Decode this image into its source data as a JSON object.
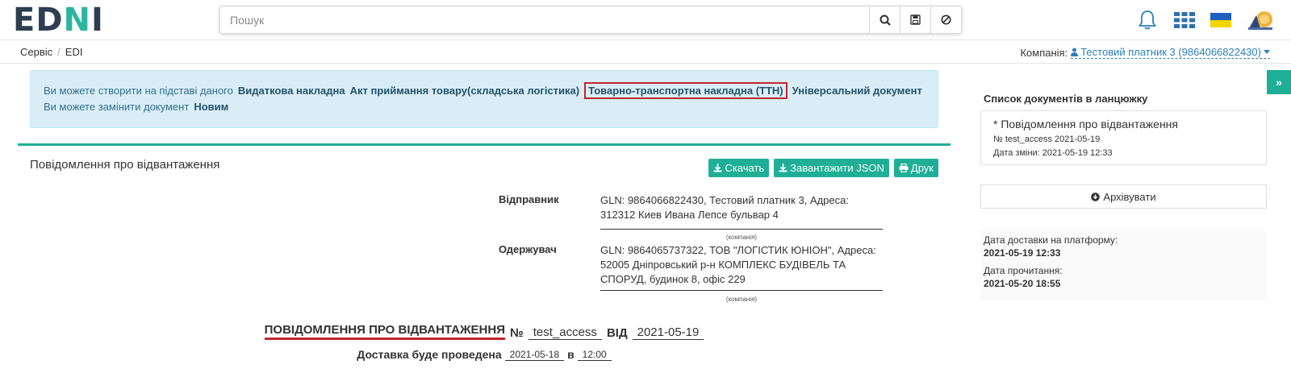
{
  "header": {
    "logo": {
      "ed": "ED",
      "n": "N",
      "i": "I"
    },
    "search": {
      "placeholder": "Пошук",
      "value": ""
    },
    "icons": {
      "search": "search-icon",
      "save": "save-icon",
      "clear": "ban-icon",
      "bell": "bell-icon",
      "apps": "grid-icon",
      "flag": "ukraine-flag-icon",
      "avatar": "avatar-icon"
    }
  },
  "breadcrumb": {
    "items": [
      "Сервіс",
      "EDI"
    ],
    "separator": "/"
  },
  "company": {
    "label": "Компанія:",
    "value": "Тестовий платник 3 (9864066822430)"
  },
  "alert": {
    "line1_prefix": "Ви можете створити на підставі даного",
    "create_links": [
      "Видаткова накладна",
      "Акт приймання товару(складська логістика)",
      "Товарно-транспортна накладна (ТТН)",
      "Універсальний документ"
    ],
    "line2_prefix": "Ви можете замінити документ",
    "replace_link": "Новим"
  },
  "main": {
    "title": "Повідомлення про відвантаження",
    "buttons": {
      "download": "Скачать",
      "download_json": "Завантажити JSON",
      "print": "Друк"
    },
    "sender": {
      "label": "Відправник",
      "value": "GLN: 9864066822430, Тестовий платник 3, Адреса: 312312 Киев Ивана Лепсе бульвар 4",
      "note": "(компанія)"
    },
    "receiver": {
      "label": "Одержувач",
      "value": "GLN: 9864065737322, ТОВ \"ЛОГІСТИК ЮНІОН\", Адреса: 52005 Дніпровський р-н КОМПЛЕКС БУДІВЕЛЬ ТА СПОРУД, будинок 8, офіс 229",
      "note": "(компанія)"
    },
    "doc": {
      "title": "ПОВІДОМЛЕННЯ ПРО ВІДВАНТАЖЕННЯ",
      "number_label": "№",
      "number": "test_access",
      "date_label": "ВІД",
      "date": "2021-05-19"
    },
    "delivery": {
      "label": "Доставка буде проведена",
      "date": "2021-05-18",
      "at": "в",
      "time": "12:00"
    }
  },
  "sidebar": {
    "toggle": "»",
    "title": "Список документів в ланцюжку",
    "chain": {
      "title": "* Повідомлення про відвантаження",
      "number": "№ test_access 2021-05-19",
      "changed": "Дата зміни: 2021-05-19 12:33"
    },
    "archive": "Архівувати",
    "delivered_label": "Дата доставки на платформу:",
    "delivered_value": "2021-05-19 12:33",
    "read_label": "Дата прочитання:",
    "read_value": "2021-05-20 18:55"
  },
  "colors": {
    "accent": "#1fae96",
    "alert_bg": "#d9edf7",
    "highlight": "#c0272d",
    "link": "#2e7fb8"
  }
}
